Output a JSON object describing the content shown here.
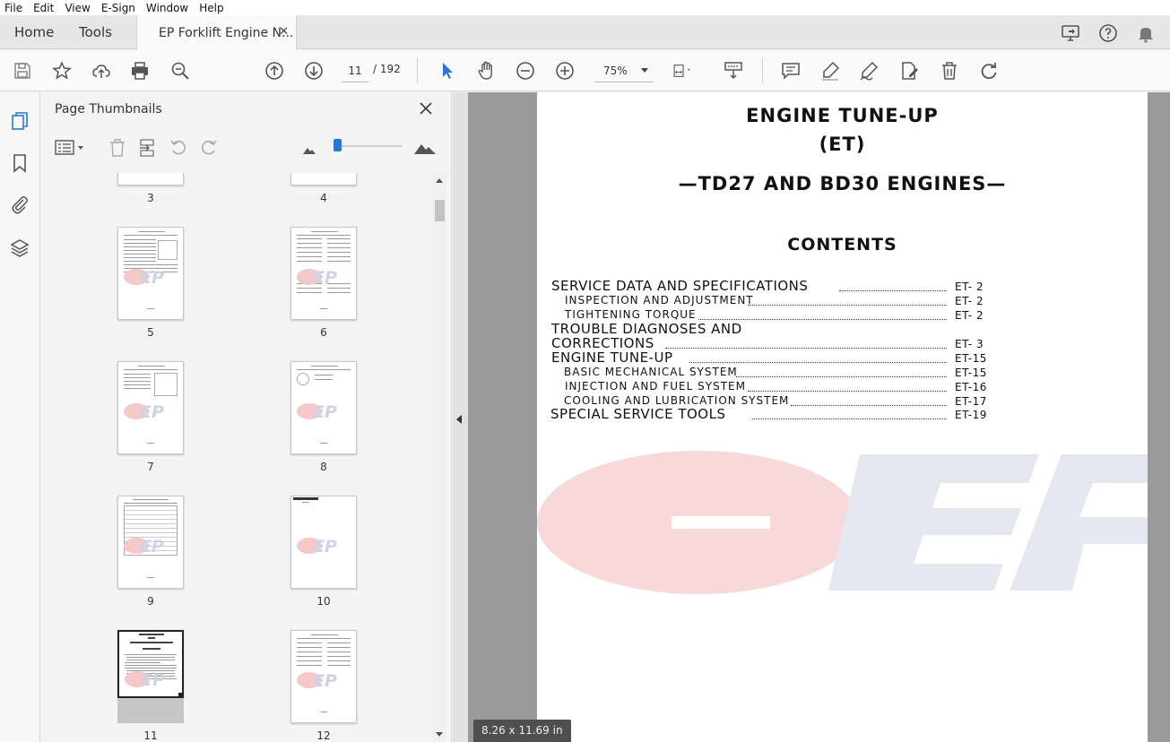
{
  "menu": [
    "File",
    "Edit",
    "View",
    "E-Sign",
    "Window",
    "Help"
  ],
  "tabs": {
    "home": "Home",
    "tools": "Tools",
    "document": "EP Forklift Engine N...",
    "close_symbol": "✕"
  },
  "toolbar": {
    "current_page": "11",
    "total_pages": "/  192",
    "zoom": "75%"
  },
  "thumbnails": {
    "title": "Page Thumbnails",
    "pages": [
      "3",
      "4",
      "5",
      "6",
      "7",
      "8",
      "9",
      "10",
      "11",
      "12"
    ],
    "selected_page": "11"
  },
  "document": {
    "title_line1": "ENGINE TUNE-UP",
    "title_line2": "(ET)",
    "subtitle": "—TD27 AND BD30 ENGINES—",
    "contents_heading": "CONTENTS",
    "toc": [
      {
        "label": "SERVICE DATA AND SPECIFICATIONS",
        "page": "ET-  2",
        "level": "main"
      },
      {
        "label": "INSPECTION  AND  ADJUSTMENT",
        "page": "ET-  2",
        "level": "sub"
      },
      {
        "label": "TIGHTENING  TORQUE",
        "page": "ET-  2",
        "level": "sub"
      },
      {
        "label": "TROUBLE DIAGNOSES AND",
        "page": "",
        "level": "main"
      },
      {
        "label": "CORRECTIONS",
        "page": "ET-  3",
        "level": "main"
      },
      {
        "label": "ENGINE TUNE-UP",
        "page": "ET-15",
        "level": "main"
      },
      {
        "label": "BASIC  MECHANICAL  SYSTEM",
        "page": "ET-15",
        "level": "sub"
      },
      {
        "label": "INJECTION  AND  FUEL  SYSTEM",
        "page": "ET-16",
        "level": "sub"
      },
      {
        "label": "COOLING  AND  LUBRICATION  SYSTEM",
        "page": "ET-17",
        "level": "sub"
      },
      {
        "label": "SPECIAL SERVICE TOOLS",
        "page": "ET-19",
        "level": "main"
      }
    ],
    "watermark": "EP",
    "page_size": "8.26 x 11.69 in"
  },
  "colors": {
    "accent": "#2a78d4",
    "watermark_red": "#f6d6d6",
    "watermark_blue": "#e4e6f0",
    "page_bg": "#ffffff",
    "doc_bg": "#9a9a9a"
  }
}
